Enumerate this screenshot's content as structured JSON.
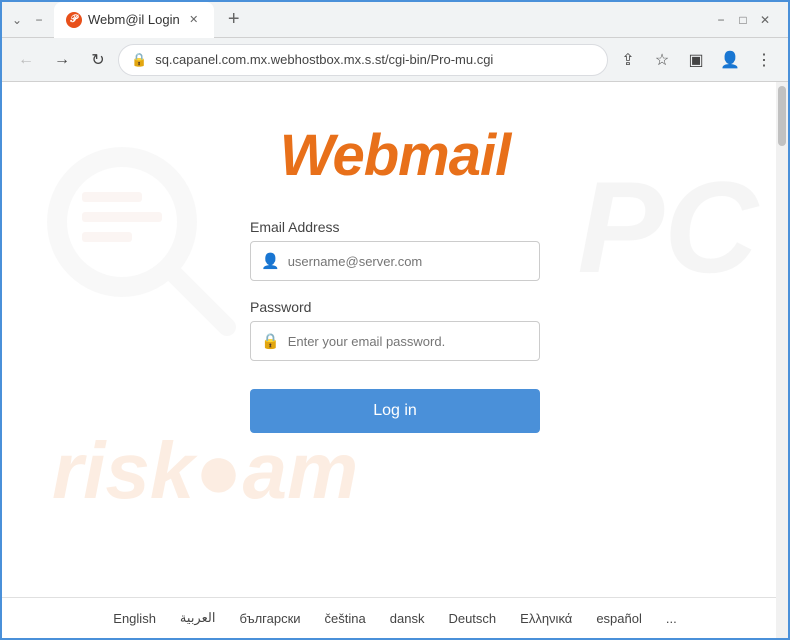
{
  "browser": {
    "title": "Webm@il Login",
    "tab_label": "Webm@il Login",
    "address": "sq.capanel.com.mx.webhostbox.mx.s.st/cgi-bin/Pro-mu.cgi",
    "new_tab_label": "+",
    "back_label": "←",
    "forward_label": "→",
    "refresh_label": "↺"
  },
  "window_controls": {
    "minimize": "−",
    "maximize": "□",
    "close": "✕",
    "chevron_down": "⌄"
  },
  "login": {
    "logo_text": "Webmail",
    "email_label": "Email Address",
    "email_placeholder": "username@server.com",
    "password_label": "Password",
    "password_placeholder": "Enter your email password.",
    "login_button": "Log in"
  },
  "languages": {
    "items": [
      {
        "label": "English"
      },
      {
        "label": "العربية"
      },
      {
        "label": "български"
      },
      {
        "label": "čeština"
      },
      {
        "label": "dansk"
      },
      {
        "label": "Deutsch"
      },
      {
        "label": "Ελληνικά"
      },
      {
        "label": "español"
      },
      {
        "label": "..."
      }
    ]
  },
  "watermark": {
    "pc_text": "PC",
    "risk_text": "risk●am"
  }
}
